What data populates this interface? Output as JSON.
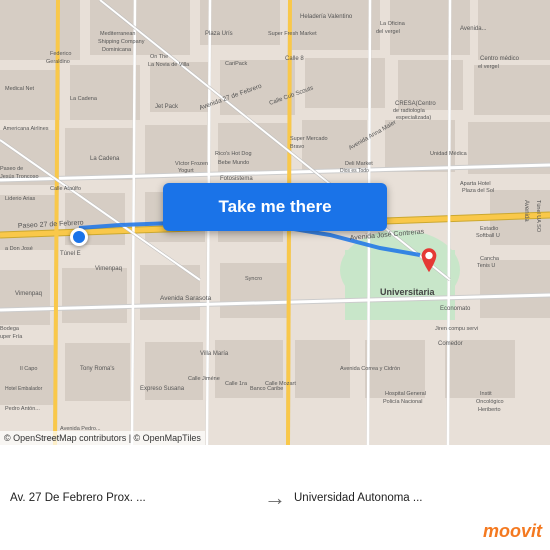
{
  "map": {
    "attribution": "© OpenStreetMap contributors | © OpenMapTiles",
    "take_me_there_label": "Take me there"
  },
  "bottom_bar": {
    "from_label": "Av. 27 De Febrero Prox. ...",
    "to_label": "Universidad Autonoma ...",
    "arrow": "→"
  },
  "brand": {
    "name": "moovit"
  }
}
